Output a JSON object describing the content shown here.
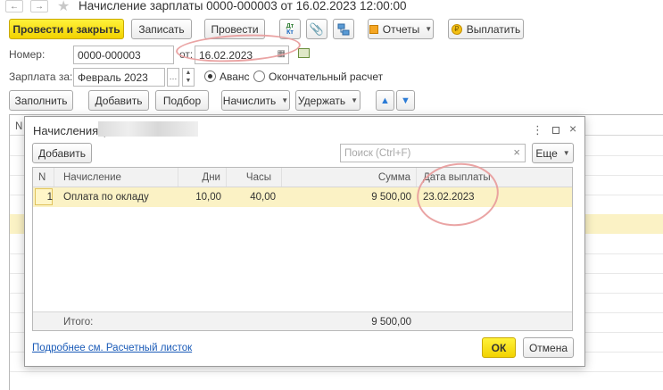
{
  "window": {
    "title": "Начисление зарплаты 0000-000003 от 16.02.2023 12:00:00"
  },
  "toolbar": {
    "post_close": "Провести и закрыть",
    "save": "Записать",
    "post": "Провести",
    "reports": "Отчеты",
    "pay": "Выплатить"
  },
  "form": {
    "number_label": "Номер:",
    "number_value": "0000-000003",
    "date_label": "от:",
    "date_value": "16.02.2023",
    "salary_for_label": "Зарплата за:",
    "salary_for_value": "Февраль 2023",
    "advance_label": "Аванс",
    "final_label": "Окончательный расчет"
  },
  "actions": {
    "fill": "Заполнить",
    "add_employee": "Добавить",
    "select": "Подбор",
    "accrue": "Начислить",
    "withhold": "Удержать"
  },
  "bg_table": {
    "first_col": "N"
  },
  "dialog": {
    "title": "Начисления (",
    "add": "Добавить",
    "search_placeholder": "Поиск (Ctrl+F)",
    "more": "Еще",
    "columns": [
      "N",
      "Начисление",
      "Дни",
      "Часы",
      "Сумма",
      "Дата выплаты"
    ],
    "rows": [
      {
        "n": "1",
        "accrual": "Оплата по окладу",
        "days": "10,00",
        "hours": "40,00",
        "sum": "9 500,00",
        "date": "23.02.2023"
      }
    ],
    "total_label": "Итого:",
    "total_sum": "9 500,00",
    "link": "Подробнее см. Расчетный листок",
    "ok": "ОК",
    "cancel": "Отмена"
  },
  "colors": {
    "accent_yellow": "#f5dc1e",
    "row_highlight": "#fbf2c5",
    "link_blue": "#1a5bb8",
    "annotation": "#e89a9a"
  }
}
